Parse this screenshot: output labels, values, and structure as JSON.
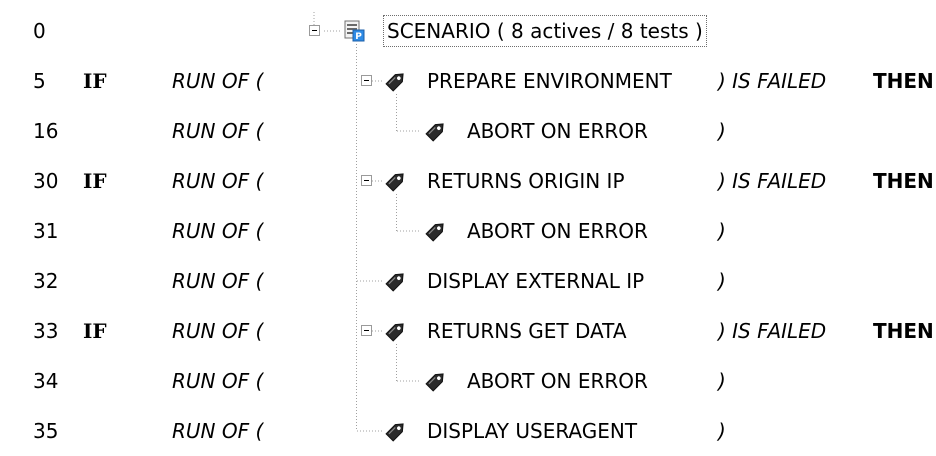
{
  "scenario": {
    "line": "0",
    "label": "SCENARIO ( 8 actives / 8 tests )",
    "icon": "scenario-p-icon"
  },
  "rows": [
    {
      "line": "5",
      "condition": "IF",
      "run_of": "RUN OF (",
      "name": "PREPARE ENVIRONMENT",
      "close": ") IS FAILED",
      "then": "THEN",
      "icon": "tag-icon",
      "level": 1,
      "expander": "minus"
    },
    {
      "line": "16",
      "condition": "",
      "run_of": "RUN OF (",
      "name": "ABORT ON ERROR",
      "close": ")",
      "then": "",
      "icon": "tag-icon",
      "level": 2,
      "expander": ""
    },
    {
      "line": "30",
      "condition": "IF",
      "run_of": "RUN OF (",
      "name": "RETURNS ORIGIN IP",
      "close": ") IS FAILED",
      "then": "THEN",
      "icon": "tag-icon",
      "level": 1,
      "expander": "minus"
    },
    {
      "line": "31",
      "condition": "",
      "run_of": "RUN OF (",
      "name": "ABORT ON ERROR",
      "close": ")",
      "then": "",
      "icon": "tag-icon",
      "level": 2,
      "expander": ""
    },
    {
      "line": "32",
      "condition": "",
      "run_of": "RUN OF (",
      "name": "DISPLAY EXTERNAL IP",
      "close": ")",
      "then": "",
      "icon": "tag-icon",
      "level": 1,
      "expander": ""
    },
    {
      "line": "33",
      "condition": "IF",
      "run_of": "RUN OF (",
      "name": "RETURNS GET DATA",
      "close": ") IS FAILED",
      "then": "THEN",
      "icon": "tag-icon",
      "level": 1,
      "expander": "minus"
    },
    {
      "line": "34",
      "condition": "",
      "run_of": "RUN OF (",
      "name": "ABORT ON ERROR",
      "close": ")",
      "then": "",
      "icon": "tag-icon",
      "level": 2,
      "expander": ""
    },
    {
      "line": "35",
      "condition": "",
      "run_of": "RUN OF (",
      "name": "DISPLAY USERAGENT",
      "close": ")",
      "then": "",
      "icon": "tag-icon",
      "level": 1,
      "expander": ""
    }
  ]
}
